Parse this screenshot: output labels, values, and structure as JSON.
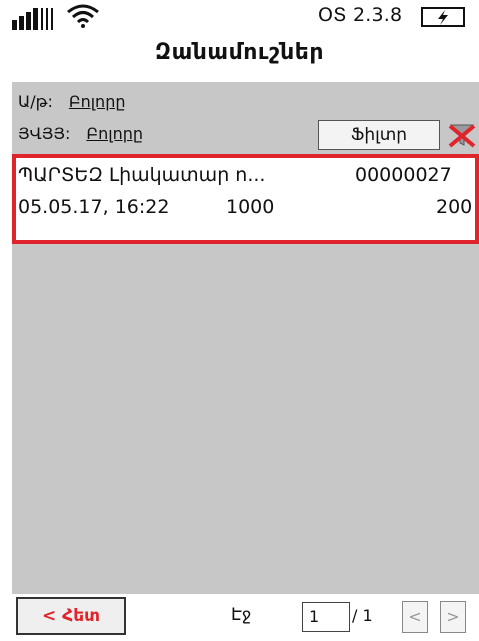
{
  "status_bar": {
    "version": "ՕՏ 2.3.8",
    "icons": [
      "signal-icon",
      "wifi-icon",
      "battery-charging-icon"
    ]
  },
  "header": {
    "title": "Զանամուշներ"
  },
  "filters": {
    "status_label": "Ա/թ:",
    "status_value": "Բոլորը",
    "type_label": "ՅՎՅՅ:",
    "type_value": "Բոլորը",
    "filter_button": "Ֆիլտր",
    "clear_icon": "clear-filter-icon"
  },
  "records": [
    {
      "title": "ՊԱՐՏԵԶ Լիակատար ո...",
      "number": "00000027",
      "datetime": "05.05.17, 16:22",
      "amount": "1000",
      "amount2": "200"
    }
  ],
  "footer": {
    "back_button": "< Հետ",
    "page_label": "Էջ",
    "page_value": "1",
    "page_total": "/ 1",
    "prev_label": "<",
    "next_label": ">"
  },
  "colors": {
    "accent_red": "#e0242c",
    "content_bg": "#c7c7c7"
  }
}
